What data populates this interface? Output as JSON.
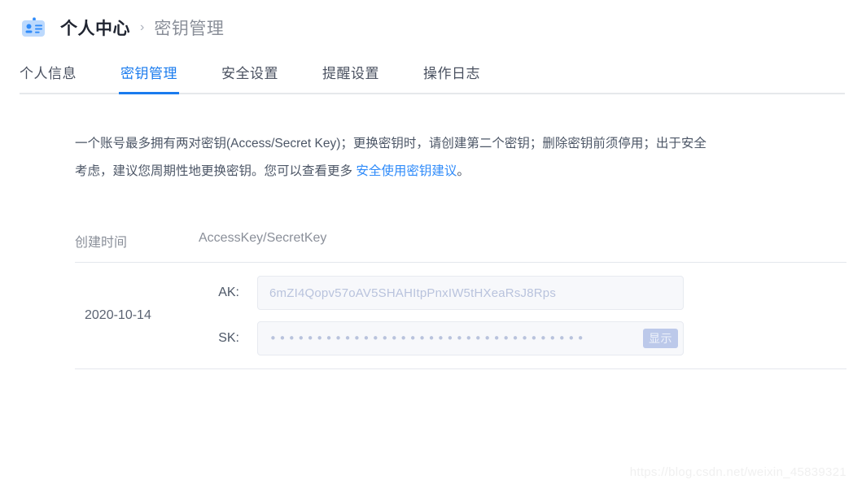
{
  "header": {
    "icon": "id-badge-icon",
    "root_label": "个人中心",
    "separator": "›",
    "current_label": "密钥管理"
  },
  "tabs": [
    {
      "label": "个人信息",
      "active": false
    },
    {
      "label": "密钥管理",
      "active": true
    },
    {
      "label": "安全设置",
      "active": false
    },
    {
      "label": "提醒设置",
      "active": false
    },
    {
      "label": "操作日志",
      "active": false
    }
  ],
  "description": {
    "text_before_link": "一个账号最多拥有两对密钥(Access/Secret Key)；更换密钥时，请创建第二个密钥；删除密钥前须停用；出于安全考虑，建议您周期性地更换密钥。您可以查看更多 ",
    "link_label": "安全使用密钥建议",
    "text_after_link": "。"
  },
  "table": {
    "columns": {
      "created_time": "创建时间",
      "keys": "AccessKey/SecretKey"
    },
    "rows": [
      {
        "created_time": "2020-10-14",
        "ak_label": "AK:",
        "ak_value": "6mZI4Qopv57oAV5SHAHItpPnxIW5tHXeaRsJ8Rps",
        "sk_label": "SK:",
        "sk_value": "••••••••••••••••••••••••••••••••••",
        "sk_show_button": "显示"
      }
    ]
  },
  "watermark": "https://blog.csdn.net/weixin_45839321",
  "colors": {
    "accent": "#1a7bee",
    "link": "#2f8bfa",
    "icon_bg": "#bcd9fd",
    "icon_fg": "#2f8bfa",
    "muted_text": "#8a8f99",
    "field_bg": "#f7f8fb",
    "show_button_bg": "#bcc9ea"
  }
}
